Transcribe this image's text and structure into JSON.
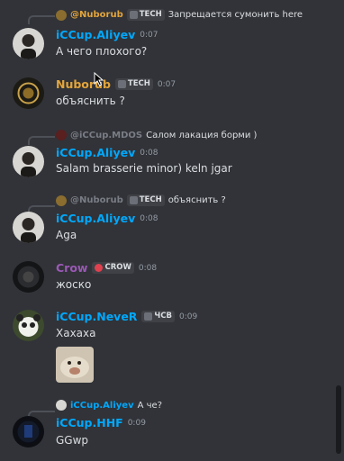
{
  "messages": [
    {
      "reply": {
        "author": "@Nuborub",
        "tag": "TECH",
        "text": "Запрещается сумонить here"
      },
      "author": "iCCup.Aliyev",
      "time": "0:07",
      "text": "А чего плохого?"
    },
    {
      "author": "Nuborub",
      "tag": "TECH",
      "time": "0:07",
      "text": "объяснить ?"
    },
    {
      "reply": {
        "author": "@iCCup.MDOS",
        "text": "Салом лакация борми )"
      },
      "author": "iCCup.Aliyev",
      "time": "0:08",
      "text": "Salam brasserie minor) keln jgar"
    },
    {
      "reply": {
        "author": "@Nuborub",
        "tag": "TECH",
        "text": "объяснить ?"
      },
      "author": "iCCup.Aliyev",
      "time": "0:08",
      "text": "Aga"
    },
    {
      "author": "Crow",
      "tag": "CROW",
      "time": "0:08",
      "text": "жоско"
    },
    {
      "author": "iCCup.NeveR",
      "tag": "ЧСВ",
      "time": "0:09",
      "text": "Хахаха"
    },
    {
      "reply": {
        "author": "iCCup.Aliyev",
        "text": "А че?"
      },
      "author": "iCCup.HHF",
      "time": "0:09",
      "text": "GGwp"
    }
  ],
  "colors": {
    "background": "#313338",
    "blue_name": "#00a8fc",
    "orange_name": "#e3a53b",
    "purple_name": "#9b59b6",
    "text": "#dbdee1",
    "muted": "#949ba4"
  }
}
